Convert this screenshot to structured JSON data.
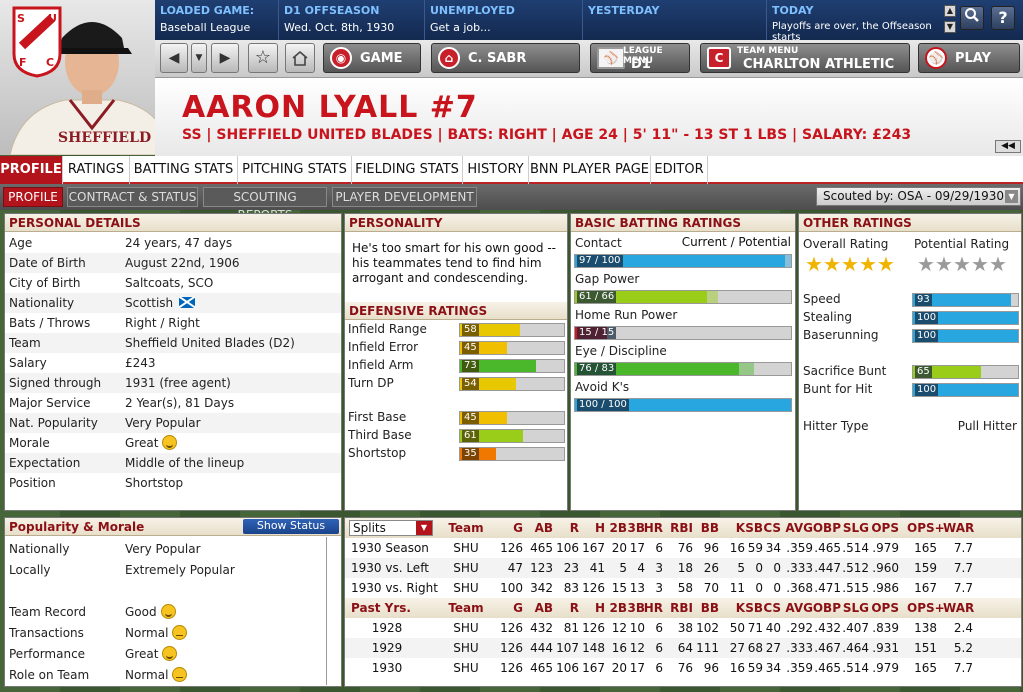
{
  "header": {
    "loaded_game": {
      "label": "LOADED GAME:",
      "value": "Baseball League"
    },
    "season": {
      "label": "D1 OFFSEASON",
      "value": "Wed. Oct. 8th, 1930"
    },
    "employment": {
      "label": "UNEMPLOYED",
      "value": "Get a job..."
    },
    "yesterday": {
      "label": "YESTERDAY",
      "value": ""
    },
    "today": {
      "label": "TODAY",
      "value": "Playoffs are over, the Offseason starts"
    }
  },
  "nav": {
    "game_label": "GAME",
    "manager_label": "C. SABR",
    "league_menu_small": "LEAGUE MENU",
    "league_menu_label": "D1",
    "team_menu_small": "TEAM MENU",
    "team_menu_label": "CHARLTON ATHLETIC",
    "play_label": "PLAY"
  },
  "logo": {
    "letters": [
      "S",
      "U",
      "F",
      "C"
    ]
  },
  "player": {
    "name": "AARON LYALL  #7",
    "info": "SS | SHEFFIELD UNITED BLADES | BATS: RIGHT | AGE 24 | 5' 11\" - 13 ST 1 LBS | SALARY: £243",
    "jersey": "SHEFFIELD"
  },
  "tabs": [
    "PROFILE",
    "RATINGS",
    "BATTING STATS",
    "PITCHING STATS",
    "FIELDING STATS",
    "HISTORY",
    "BNN PLAYER PAGE",
    "EDITOR"
  ],
  "subtabs": [
    "PROFILE",
    "CONTRACT & STATUS",
    "SCOUTING REPORTS",
    "PLAYER DEVELOPMENT"
  ],
  "scouted_by": "Scouted by: OSA - 09/29/1930",
  "personal": {
    "title": "PERSONAL DETAILS",
    "rows": [
      {
        "k": "Age",
        "v": "24 years, 47 days"
      },
      {
        "k": "Date of Birth",
        "v": "August 22nd, 1906"
      },
      {
        "k": "City of Birth",
        "v": "Saltcoats, SCO"
      },
      {
        "k": "Nationality",
        "v": "Scottish"
      },
      {
        "k": "Bats / Throws",
        "v": "Right / Right"
      },
      {
        "k": "Team",
        "v": "Sheffield United Blades (D2)"
      },
      {
        "k": "Salary",
        "v": "£243"
      },
      {
        "k": "Signed through",
        "v": "1931 (free agent)"
      },
      {
        "k": "Major Service",
        "v": "2 Year(s), 81 Days"
      },
      {
        "k": "Nat. Popularity",
        "v": "Very Popular"
      },
      {
        "k": "Morale",
        "v": "Great"
      },
      {
        "k": "Expectation",
        "v": "Middle of the lineup"
      },
      {
        "k": "Position",
        "v": "Shortstop"
      }
    ]
  },
  "personality": {
    "title": "PERSONALITY",
    "text": "He's too smart for his own good -- his teammates tend to find him arrogant and condescending."
  },
  "defensive": {
    "title": "DEFENSIVE RATINGS",
    "rows": [
      {
        "k": "Infield Range",
        "v": 58,
        "c": "#e8c800"
      },
      {
        "k": "Infield Error",
        "v": 45,
        "c": "#f0c000"
      },
      {
        "k": "Infield Arm",
        "v": 73,
        "c": "#4ab82a"
      },
      {
        "k": "Turn DP",
        "v": 54,
        "c": "#e8c800"
      },
      {
        "k": "First Base",
        "v": 45,
        "c": "#f0c000"
      },
      {
        "k": "Third Base",
        "v": 61,
        "c": "#9acd1a"
      },
      {
        "k": "Shortstop",
        "v": 35,
        "c": "#f07800"
      }
    ]
  },
  "batting": {
    "title": "BASIC BATTING RATINGS",
    "cp_label": "Current / Potential",
    "rows": [
      {
        "k": "Contact",
        "cur": 97,
        "pot": 100,
        "text": "97 / 100",
        "c": "#28a6e0"
      },
      {
        "k": "Gap Power",
        "cur": 61,
        "pot": 66,
        "text": "61 / 66",
        "c": "#9acd1a"
      },
      {
        "k": "Home Run Power",
        "cur": 15,
        "pot": 15,
        "text": "15 / 15",
        "c": "#d8141c"
      },
      {
        "k": "Eye / Discipline",
        "cur": 76,
        "pot": 83,
        "text": "76 / 83",
        "c": "#4ab82a"
      },
      {
        "k": "Avoid K's",
        "cur": 100,
        "pot": 100,
        "text": "100 / 100",
        "c": "#28a6e0"
      }
    ]
  },
  "other": {
    "title": "OTHER RATINGS",
    "overall_label": "Overall Rating",
    "potential_label": "Potential Rating",
    "overall_stars": 5,
    "potential_stars": 0,
    "rows": [
      {
        "k": "Speed",
        "v": 93,
        "c": "#28a6e0"
      },
      {
        "k": "Stealing",
        "v": 100,
        "c": "#28a6e0"
      },
      {
        "k": "Baserunning",
        "v": 100,
        "c": "#28a6e0"
      },
      {
        "k": "Sacrifice Bunt",
        "v": 65,
        "c": "#9acd1a"
      },
      {
        "k": "Bunt for Hit",
        "v": 100,
        "c": "#28a6e0"
      }
    ],
    "hitter_type_label": "Hitter Type",
    "hitter_type": "Pull Hitter"
  },
  "popularity": {
    "title": "Popularity & Morale",
    "show_status": "Show Status",
    "rows": [
      {
        "k": "Nationally",
        "v": "Very Popular",
        "face": ""
      },
      {
        "k": "Locally",
        "v": "Extremely Popular",
        "face": ""
      },
      {
        "k": "",
        "v": "",
        "face": ""
      },
      {
        "k": "Team Record",
        "v": "Good",
        "face": "smile"
      },
      {
        "k": "Transactions",
        "v": "Normal",
        "face": "neutral"
      },
      {
        "k": "Performance",
        "v": "Great",
        "face": "smile"
      },
      {
        "k": "Role on Team",
        "v": "Normal",
        "face": "neutral"
      }
    ]
  },
  "stats": {
    "splits_label": "Splits",
    "columns": [
      "Team",
      "G",
      "AB",
      "R",
      "H",
      "2B",
      "3B",
      "HR",
      "RBI",
      "BB",
      "K",
      "SB",
      "CS",
      "AVG",
      "OBP",
      "SLG",
      "OPS",
      "OPS+",
      "WAR"
    ],
    "rows": [
      [
        "1930 Season",
        "SHU",
        "126",
        "465",
        "106",
        "167",
        "20",
        "17",
        "6",
        "76",
        "96",
        "16",
        "59",
        "34",
        ".359",
        ".465",
        ".514",
        ".979",
        "165",
        "7.7"
      ],
      [
        "1930 vs. Left",
        "SHU",
        "47",
        "123",
        "23",
        "41",
        "5",
        "4",
        "3",
        "18",
        "26",
        "5",
        "0",
        "0",
        ".333",
        ".447",
        ".512",
        ".960",
        "159",
        "7.7"
      ],
      [
        "1930 vs. Right",
        "SHU",
        "100",
        "342",
        "83",
        "126",
        "15",
        "13",
        "3",
        "58",
        "70",
        "11",
        "0",
        "0",
        ".368",
        ".471",
        ".515",
        ".986",
        "167",
        "7.7"
      ]
    ],
    "past_label": "Past Yrs.",
    "past_rows": [
      [
        "1928",
        "SHU",
        "126",
        "432",
        "81",
        "126",
        "12",
        "10",
        "6",
        "38",
        "102",
        "50",
        "71",
        "40",
        ".292",
        ".432",
        ".407",
        ".839",
        "138",
        "2.4"
      ],
      [
        "1929",
        "SHU",
        "126",
        "444",
        "107",
        "148",
        "16",
        "12",
        "6",
        "64",
        "111",
        "27",
        "68",
        "27",
        ".333",
        ".467",
        ".464",
        ".931",
        "151",
        "5.2"
      ],
      [
        "1930",
        "SHU",
        "126",
        "465",
        "106",
        "167",
        "20",
        "17",
        "6",
        "76",
        "96",
        "16",
        "59",
        "34",
        ".359",
        ".465",
        ".514",
        ".979",
        "165",
        "7.7"
      ]
    ]
  }
}
